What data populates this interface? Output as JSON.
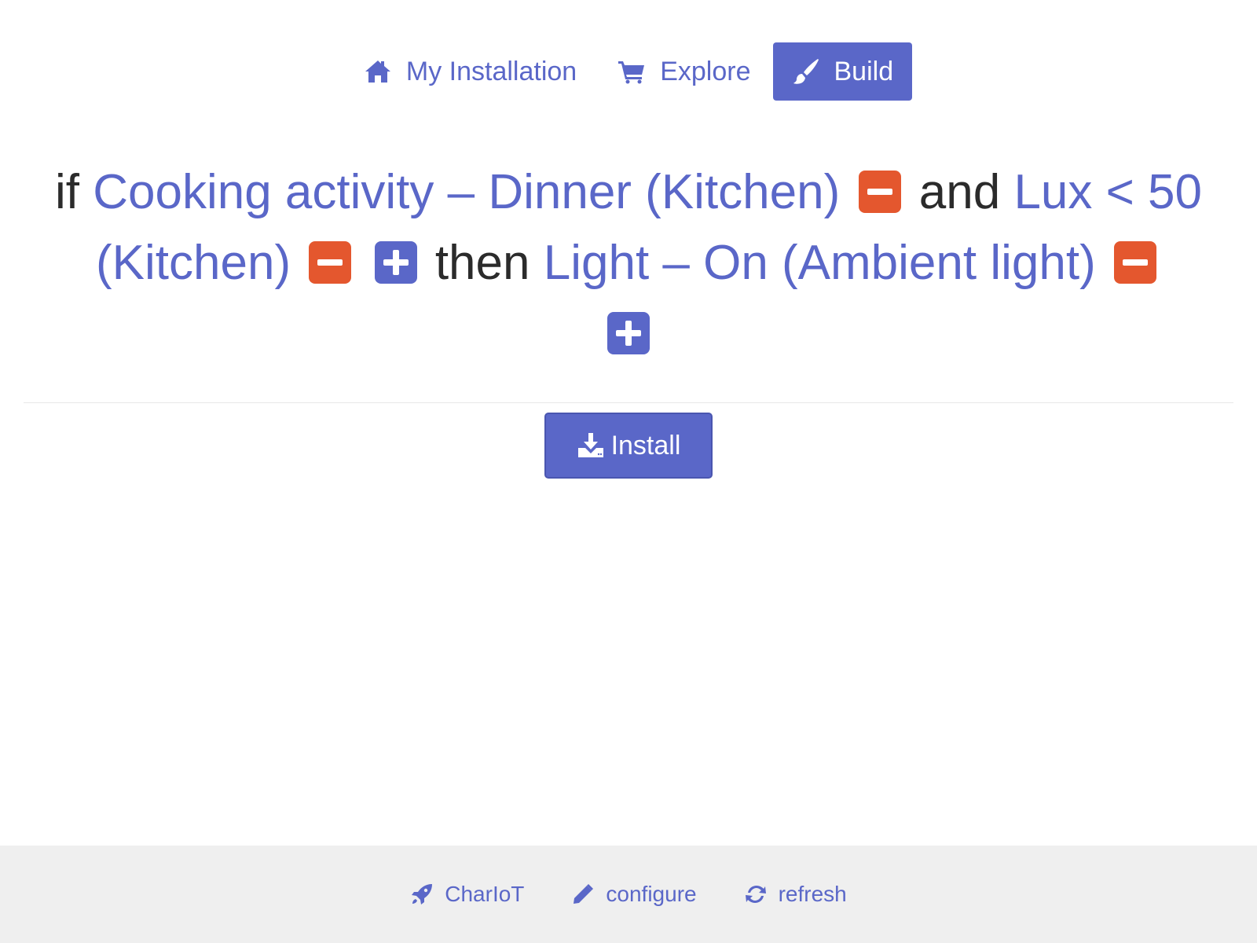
{
  "nav": {
    "items": [
      {
        "label": "My Installation",
        "icon": "home-icon",
        "active": false
      },
      {
        "label": "Explore",
        "icon": "cart-icon",
        "active": false
      },
      {
        "label": "Build",
        "icon": "paintbrush-icon",
        "active": true
      }
    ]
  },
  "rule": {
    "if_keyword": "if",
    "trigger1": "Cooking activity – Dinner (Kitchen)",
    "and_keyword": "and",
    "trigger2": "Lux < 50 (Kitchen)",
    "then_keyword": "then",
    "action1": "Light – On (Ambient light)"
  },
  "install_button": {
    "label": "Install",
    "icon": "download-icon"
  },
  "footer": {
    "items": [
      {
        "label": "CharIoT",
        "icon": "rocket-icon"
      },
      {
        "label": "configure",
        "icon": "pencil-icon"
      },
      {
        "label": "refresh",
        "icon": "refresh-icon"
      }
    ]
  },
  "colors": {
    "accent": "#5a67c8",
    "remove": "#e4572e",
    "text": "#2b2b2b",
    "footer_bg": "#efefef"
  }
}
